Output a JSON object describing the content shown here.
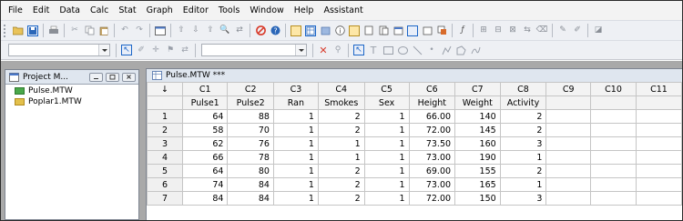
{
  "menu": [
    "File",
    "Edit",
    "Data",
    "Calc",
    "Stat",
    "Graph",
    "Editor",
    "Tools",
    "Window",
    "Help",
    "Assistant"
  ],
  "project_manager": {
    "title": "Project M...",
    "items": [
      {
        "label": "Pulse.MTW",
        "color": "#4aa84a"
      },
      {
        "label": "Poplar1.MTW",
        "color": "#e3c04b"
      }
    ]
  },
  "worksheet": {
    "title": "Pulse.MTW ***",
    "corner": "↓",
    "column_ids": [
      "C1",
      "C2",
      "C3",
      "C4",
      "C5",
      "C6",
      "C7",
      "C8",
      "C9",
      "C10",
      "C11"
    ],
    "column_names": [
      "Pulse1",
      "Pulse2",
      "Ran",
      "Smokes",
      "Sex",
      "Height",
      "Weight",
      "Activity",
      "",
      "",
      ""
    ],
    "rows": [
      {
        "n": "1",
        "cells": [
          "64",
          "88",
          "1",
          "2",
          "1",
          "66.00",
          "140",
          "2"
        ]
      },
      {
        "n": "2",
        "cells": [
          "58",
          "70",
          "1",
          "2",
          "1",
          "72.00",
          "145",
          "2"
        ]
      },
      {
        "n": "3",
        "cells": [
          "62",
          "76",
          "1",
          "1",
          "1",
          "73.50",
          "160",
          "3"
        ]
      },
      {
        "n": "4",
        "cells": [
          "66",
          "78",
          "1",
          "1",
          "1",
          "73.00",
          "190",
          "1"
        ]
      },
      {
        "n": "5",
        "cells": [
          "64",
          "80",
          "1",
          "2",
          "1",
          "69.00",
          "155",
          "2"
        ]
      },
      {
        "n": "6",
        "cells": [
          "74",
          "84",
          "1",
          "2",
          "1",
          "73.00",
          "165",
          "1"
        ]
      },
      {
        "n": "7",
        "cells": [
          "84",
          "84",
          "1",
          "2",
          "1",
          "72.00",
          "150",
          "3"
        ]
      }
    ]
  },
  "colors": {
    "accent": "#1c66c7",
    "stop": "#d83b2b"
  }
}
